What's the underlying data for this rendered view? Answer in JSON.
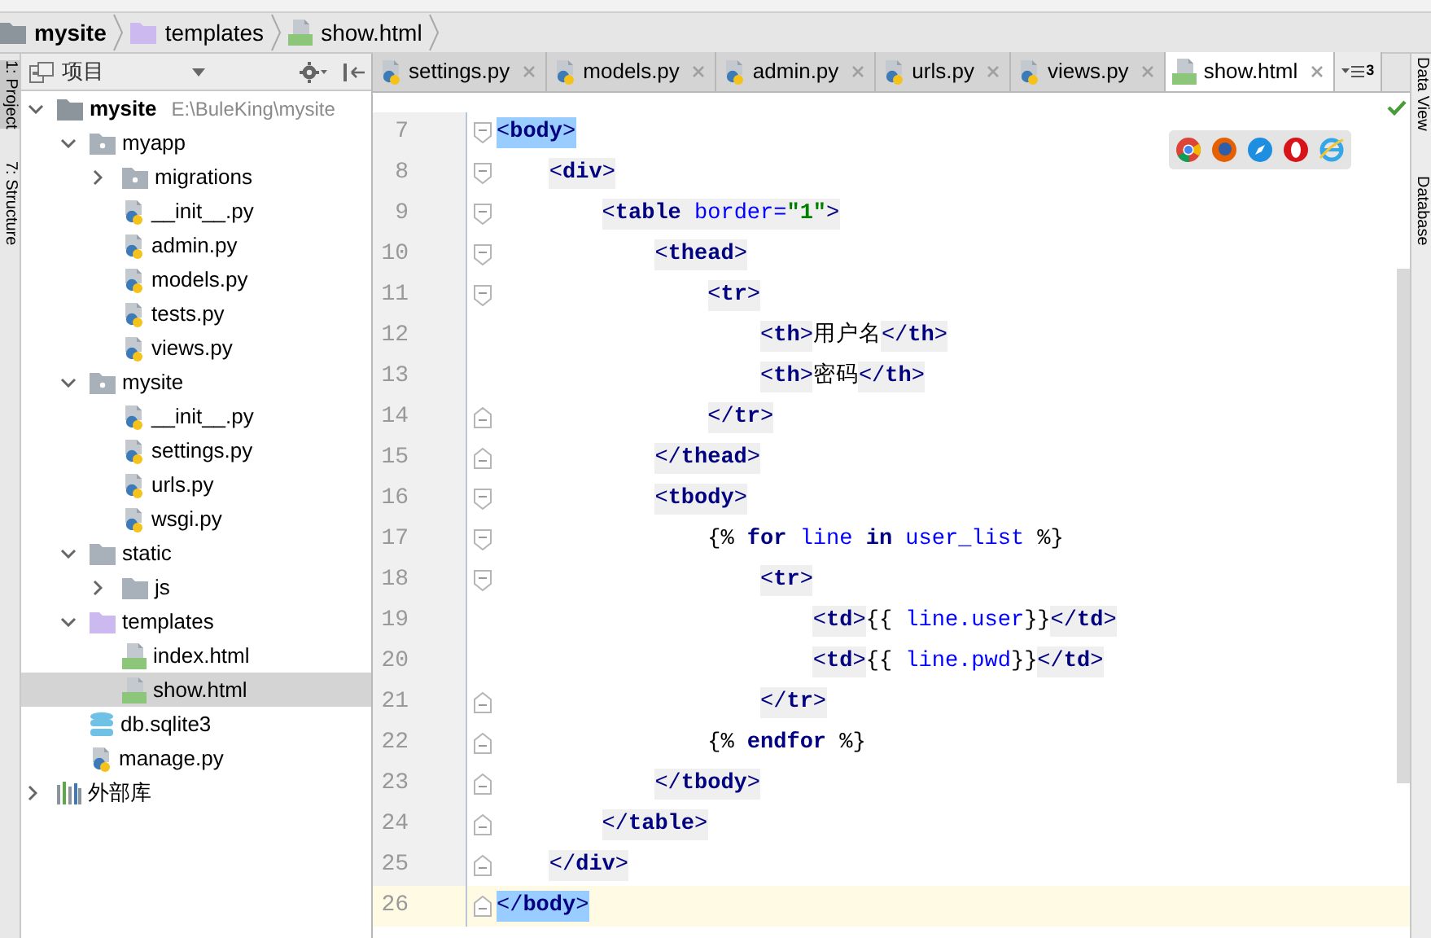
{
  "breadcrumb": [
    {
      "label": "mysite",
      "kind": "root"
    },
    {
      "label": "templates",
      "kind": "templates"
    },
    {
      "label": "show.html",
      "kind": "html"
    }
  ],
  "left_tool_windows": [
    {
      "label": "1: Project",
      "selected": true
    },
    {
      "label": "7: Structure",
      "selected": false
    }
  ],
  "right_tool_windows": [
    {
      "label": "Data View"
    },
    {
      "label": "Database"
    }
  ],
  "project_panel": {
    "title": "项目"
  },
  "tree": [
    {
      "label": "mysite",
      "path": "E:\\BuleKing\\mysite",
      "kind": "root",
      "expanded": true,
      "selected": false,
      "children": [
        {
          "label": "myapp",
          "kind": "package",
          "expanded": true,
          "selected": false,
          "children": [
            {
              "label": "migrations",
              "kind": "package",
              "expanded": false,
              "selected": false
            },
            {
              "label": "__init__.py",
              "kind": "python",
              "selected": false
            },
            {
              "label": "admin.py",
              "kind": "python",
              "selected": false
            },
            {
              "label": "models.py",
              "kind": "python",
              "selected": false
            },
            {
              "label": "tests.py",
              "kind": "python",
              "selected": false
            },
            {
              "label": "views.py",
              "kind": "python",
              "selected": false
            }
          ]
        },
        {
          "label": "mysite",
          "kind": "package",
          "expanded": true,
          "selected": false,
          "children": [
            {
              "label": "__init__.py",
              "kind": "python",
              "selected": false
            },
            {
              "label": "settings.py",
              "kind": "python",
              "selected": false
            },
            {
              "label": "urls.py",
              "kind": "python",
              "selected": false
            },
            {
              "label": "wsgi.py",
              "kind": "python",
              "selected": false
            }
          ]
        },
        {
          "label": "static",
          "kind": "folder",
          "expanded": true,
          "selected": false,
          "children": [
            {
              "label": "js",
              "kind": "folder",
              "expanded": false,
              "selected": false
            }
          ]
        },
        {
          "label": "templates",
          "kind": "templates",
          "expanded": true,
          "selected": false,
          "children": [
            {
              "label": "index.html",
              "kind": "html",
              "selected": false
            },
            {
              "label": "show.html",
              "kind": "html",
              "selected": true
            }
          ]
        },
        {
          "label": "db.sqlite3",
          "kind": "database",
          "selected": false
        },
        {
          "label": "manage.py",
          "kind": "python",
          "selected": false
        }
      ]
    },
    {
      "label": "外部库",
      "kind": "library",
      "expanded": false,
      "selected": false
    }
  ],
  "tabs": [
    {
      "label": "settings.py",
      "kind": "python",
      "selected": false
    },
    {
      "label": "models.py",
      "kind": "python",
      "selected": false
    },
    {
      "label": "admin.py",
      "kind": "python",
      "selected": false
    },
    {
      "label": "urls.py",
      "kind": "python",
      "selected": false
    },
    {
      "label": "views.py",
      "kind": "python",
      "selected": false
    },
    {
      "label": "show.html",
      "kind": "html",
      "selected": true
    }
  ],
  "tab_overflow": {
    "count": "3"
  },
  "browser_buttons": [
    {
      "kind": "chrome"
    },
    {
      "kind": "firefox"
    },
    {
      "kind": "safari"
    },
    {
      "kind": "opera"
    },
    {
      "kind": "ie"
    }
  ],
  "lines": [
    {
      "number": "7",
      "kind": "fold-start",
      "current": false,
      "brace_match": true,
      "tokens": [
        {
          "kind": "bracket",
          "text": "<"
        },
        {
          "kind": "tag",
          "text": "body"
        },
        {
          "kind": "bracket",
          "text": ">"
        }
      ]
    },
    {
      "number": "8",
      "kind": "fold-start",
      "current": false,
      "tokens": [
        {
          "kind": "bracket",
          "text": "<"
        },
        {
          "kind": "tag",
          "text": "div"
        },
        {
          "kind": "bracket",
          "text": ">"
        }
      ]
    },
    {
      "number": "9",
      "kind": "fold-start",
      "current": false,
      "tokens": [
        {
          "kind": "bracket",
          "text": "<"
        },
        {
          "kind": "tag",
          "text": "table"
        },
        {
          "kind": "attr",
          "text": " border="
        },
        {
          "kind": "value",
          "text": "\"1\""
        },
        {
          "kind": "bracket",
          "text": ">"
        }
      ]
    },
    {
      "number": "10",
      "kind": "fold-start",
      "current": false,
      "tokens": [
        {
          "kind": "bracket",
          "text": "<"
        },
        {
          "kind": "tag",
          "text": "thead"
        },
        {
          "kind": "bracket",
          "text": ">"
        }
      ]
    },
    {
      "number": "11",
      "kind": "fold-start",
      "current": false,
      "tokens": [
        {
          "kind": "bracket",
          "text": "<"
        },
        {
          "kind": "tag",
          "text": "tr"
        },
        {
          "kind": "bracket",
          "text": ">"
        }
      ]
    },
    {
      "number": "12",
      "kind": "plain",
      "current": false,
      "tokens": [
        {
          "kind": "bracket",
          "text": "<"
        },
        {
          "kind": "tag",
          "text": "th"
        },
        {
          "kind": "bracket",
          "text": ">"
        },
        {
          "kind": "plain",
          "text": "用户名"
        },
        {
          "kind": "bracket",
          "text": "</"
        },
        {
          "kind": "tag",
          "text": "th"
        },
        {
          "kind": "bracket",
          "text": ">"
        }
      ]
    },
    {
      "number": "13",
      "kind": "plain",
      "current": false,
      "tokens": [
        {
          "kind": "bracket",
          "text": "<"
        },
        {
          "kind": "tag",
          "text": "th"
        },
        {
          "kind": "bracket",
          "text": ">"
        },
        {
          "kind": "plain",
          "text": "密码"
        },
        {
          "kind": "bracket",
          "text": "</"
        },
        {
          "kind": "tag",
          "text": "th"
        },
        {
          "kind": "bracket",
          "text": ">"
        }
      ]
    },
    {
      "number": "14",
      "kind": "fold-end",
      "current": false,
      "tokens": [
        {
          "kind": "bracket",
          "text": "</"
        },
        {
          "kind": "tag",
          "text": "tr"
        },
        {
          "kind": "bracket",
          "text": ">"
        }
      ]
    },
    {
      "number": "15",
      "kind": "fold-end",
      "current": false,
      "tokens": [
        {
          "kind": "bracket",
          "text": "</"
        },
        {
          "kind": "tag",
          "text": "thead"
        },
        {
          "kind": "bracket",
          "text": ">"
        }
      ]
    },
    {
      "number": "16",
      "kind": "fold-start",
      "current": false,
      "tokens": [
        {
          "kind": "bracket",
          "text": "<"
        },
        {
          "kind": "tag",
          "text": "tbody"
        },
        {
          "kind": "bracket",
          "text": ">"
        }
      ]
    },
    {
      "number": "17",
      "kind": "fold-start",
      "current": false,
      "tokens": [
        {
          "kind": "plain",
          "text": "{% "
        },
        {
          "kind": "keyword",
          "text": "for"
        },
        {
          "kind": "variable",
          "text": " line"
        },
        {
          "kind": "keyword",
          "text": " in"
        },
        {
          "kind": "variable",
          "text": " user_list"
        },
        {
          "kind": "plain",
          "text": " %}"
        }
      ]
    },
    {
      "number": "18",
      "kind": "fold-start",
      "current": false,
      "tokens": [
        {
          "kind": "bracket",
          "text": "<"
        },
        {
          "kind": "tag",
          "text": "tr"
        },
        {
          "kind": "bracket",
          "text": ">"
        }
      ]
    },
    {
      "number": "19",
      "kind": "plain",
      "current": false,
      "tokens": [
        {
          "kind": "bracket",
          "text": "<"
        },
        {
          "kind": "tag",
          "text": "td"
        },
        {
          "kind": "bracket",
          "text": ">"
        },
        {
          "kind": "plain",
          "text": "{{ "
        },
        {
          "kind": "variable",
          "text": "line.user"
        },
        {
          "kind": "plain",
          "text": "}}"
        },
        {
          "kind": "bracket",
          "text": "</"
        },
        {
          "kind": "tag",
          "text": "td"
        },
        {
          "kind": "bracket",
          "text": ">"
        }
      ]
    },
    {
      "number": "20",
      "kind": "plain",
      "current": false,
      "tokens": [
        {
          "kind": "bracket",
          "text": "<"
        },
        {
          "kind": "tag",
          "text": "td"
        },
        {
          "kind": "bracket",
          "text": ">"
        },
        {
          "kind": "plain",
          "text": "{{ "
        },
        {
          "kind": "variable",
          "text": "line.pwd"
        },
        {
          "kind": "plain",
          "text": "}}"
        },
        {
          "kind": "bracket",
          "text": "</"
        },
        {
          "kind": "tag",
          "text": "td"
        },
        {
          "kind": "bracket",
          "text": ">"
        }
      ]
    },
    {
      "number": "21",
      "kind": "fold-end",
      "current": false,
      "tokens": [
        {
          "kind": "bracket",
          "text": "</"
        },
        {
          "kind": "tag",
          "text": "tr"
        },
        {
          "kind": "bracket",
          "text": ">"
        }
      ]
    },
    {
      "number": "22",
      "kind": "fold-end",
      "current": false,
      "tokens": [
        {
          "kind": "plain",
          "text": "{% "
        },
        {
          "kind": "keyword",
          "text": "endfor"
        },
        {
          "kind": "plain",
          "text": " %}"
        }
      ]
    },
    {
      "number": "23",
      "kind": "fold-end",
      "current": false,
      "tokens": [
        {
          "kind": "bracket",
          "text": "</"
        },
        {
          "kind": "tag",
          "text": "tbody"
        },
        {
          "kind": "bracket",
          "text": ">"
        }
      ]
    },
    {
      "number": "24",
      "kind": "fold-end",
      "current": false,
      "tokens": [
        {
          "kind": "bracket",
          "text": "</"
        },
        {
          "kind": "tag",
          "text": "table"
        },
        {
          "kind": "bracket",
          "text": ">"
        }
      ]
    },
    {
      "number": "25",
      "kind": "fold-end",
      "current": false,
      "tokens": [
        {
          "kind": "bracket",
          "text": "</"
        },
        {
          "kind": "tag",
          "text": "div"
        },
        {
          "kind": "bracket",
          "text": ">"
        }
      ]
    },
    {
      "number": "26",
      "kind": "fold-end",
      "current": true,
      "brace_match": true,
      "tokens": [
        {
          "kind": "bracket",
          "text": "</"
        },
        {
          "kind": "tag",
          "text": "body"
        },
        {
          "kind": "bracket",
          "text": ">"
        }
      ]
    }
  ]
}
